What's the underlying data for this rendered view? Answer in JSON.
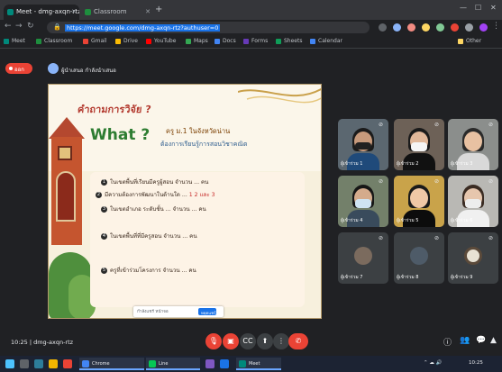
{
  "browser": {
    "tabs": [
      {
        "title": "Meet - dmg-axqn-rtz"
      },
      {
        "title": "Classroom"
      }
    ],
    "address": {
      "url": "https://meet.google.com/dmg-axqn-rtz?authuser=0",
      "highlight": "meet.google.com/dmg-axqn-rtz"
    },
    "bookmarks": [
      "Meet",
      "Classroom",
      "Gmail",
      "Drive",
      "YouTube",
      "Maps",
      "Docs",
      "Forms",
      "Sheets",
      "Calendar",
      "Other"
    ]
  },
  "meet": {
    "leave_label": "ออก",
    "presenter_label": "ผู้นำเสนอ กำลังนำเสนอ",
    "meeting_code": "dmg-axqn-rtz",
    "time": "10:25",
    "controls": [
      "mic-off",
      "camera-off",
      "caption",
      "present",
      "more",
      "end-call"
    ]
  },
  "slide": {
    "title": "คำถามการวิจัย ?",
    "what": "What ?",
    "subtitle1": "ครู ม.1 ในจังหวัดน่าน",
    "subtitle2": "ต้องการเรียนรู้การสอนวิชาคณิต",
    "bullets": [
      {
        "num": "1",
        "text": "ในเขตพื้นที่เรียนมีครูผู้สอน จำนวน ... คน",
        "highlight": ""
      },
      {
        "num": "2",
        "text": "มีความต้องการพัฒนาในด้านใด ... ",
        "highlight": "1 2 และ 3"
      },
      {
        "num": "3",
        "text": "ในเขตอำเภอ ระดับชั้น ... จำนวน ... คน",
        "highlight": ""
      },
      {
        "num": "4",
        "text": "ในเขตพื้นที่ที่มีครูสอน จำนวน ... คน",
        "highlight": ""
      },
      {
        "num": "5",
        "text": "ครูที่เข้าร่วมโครงการ จำนวน ... คน",
        "highlight": ""
      }
    ],
    "share_bar_text": "กำลังแชร์ หน้าจอ",
    "share_bar_button": "หยุดแชร์"
  },
  "tiles": [
    {
      "name": "ผู้เข้าร่วม 1",
      "wall": "#5b6770",
      "head": "#c79a7c",
      "hair": "#1b1b1b",
      "mask": "#212121",
      "body": "#1f4a7a",
      "muted": true
    },
    {
      "name": "ผู้เข้าร่วม 2",
      "wall": "#6d6157",
      "head": "#e1b89a",
      "hair": "#1a1a1a",
      "mask": "#f5f5f5",
      "body": "#111111",
      "muted": true
    },
    {
      "name": "ผู้เข้าร่วม 3",
      "wall": "#8b8e8c",
      "head": "#e8c1a2",
      "hair": "#2a2a2a",
      "mask": "",
      "body": "#d9d9d9",
      "muted": true
    },
    {
      "name": "ผู้เข้าร่วม 4",
      "wall": "#73806a",
      "head": "#d4ab8c",
      "hair": "#161616",
      "mask": "#cfe4f2",
      "body": "#394b5c",
      "muted": true
    },
    {
      "name": "ผู้เข้าร่วม 5",
      "wall": "#c9a34a",
      "head": "#f0c8a6",
      "hair": "#1a1a1a",
      "mask": "",
      "body": "#0c0c0c",
      "muted": true
    },
    {
      "name": "ผู้เข้าร่วม 6",
      "wall": "#b9b8b4",
      "head": "#e6c6ad",
      "hair": "#3a2b22",
      "mask": "#ededed",
      "body": "#f0f0f0",
      "muted": true
    },
    {
      "name": "ผู้เข้าร่วม 7",
      "wall": "#3c4043",
      "avatar": "#7b6b5e",
      "muted": true
    },
    {
      "name": "ผู้เข้าร่วม 8",
      "wall": "#3c4043",
      "avatar": "#4e5b68",
      "muted": true
    },
    {
      "name": "ผู้เข้าร่วม 9",
      "wall": "#3c4043",
      "avatar": "#e8e2d4",
      "muted": true
    }
  ],
  "taskbar": {
    "apps": [
      "Chrome",
      "Line",
      "Meet"
    ],
    "time": "10:25"
  },
  "colors": {
    "meet_bg": "#202124",
    "end_red": "#ea4335",
    "accent_blue": "#1a73e8"
  }
}
